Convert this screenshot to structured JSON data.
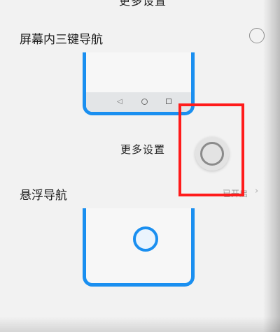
{
  "header": {
    "more_settings_top": "更多设置"
  },
  "options": [
    {
      "label": "屏幕内三键导航",
      "selected": false
    },
    {
      "label": "悬浮导航",
      "status": "已开启"
    }
  ],
  "links": {
    "more_settings": "更多设置"
  },
  "icons": {
    "nav_back": "triangle-left-icon",
    "nav_home": "circle-icon",
    "nav_recent": "square-icon",
    "status_chevron": "chevron-right-icon",
    "float_nav": "floating-nav-ball-icon"
  },
  "colors": {
    "accent": "#1a8ff0",
    "highlight": "#ff1b1b"
  }
}
